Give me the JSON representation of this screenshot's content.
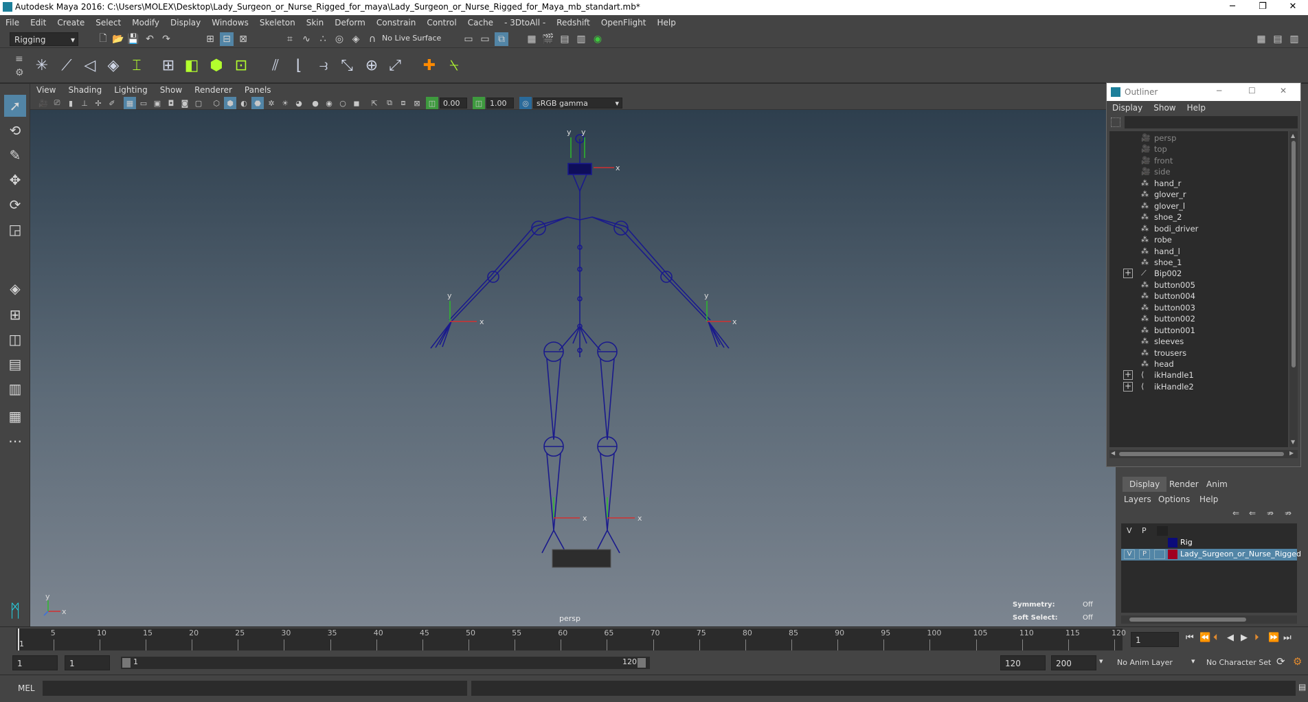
{
  "window": {
    "title": "Autodesk Maya 2016: C:\\Users\\MOLEX\\Desktop\\Lady_Surgeon_or_Nurse_Rigged_for_maya\\Lady_Surgeon_or_Nurse_Rigged_for_Maya_mb_standart.mb*"
  },
  "menubar": [
    "File",
    "Edit",
    "Create",
    "Select",
    "Modify",
    "Display",
    "Windows",
    "Skeleton",
    "Skin",
    "Deform",
    "Constrain",
    "Control",
    "Cache",
    "- 3DtoAll -",
    "Redshift",
    "OpenFlight",
    "Help"
  ],
  "status_line": {
    "mode": "Rigging",
    "live_surface": "No Live Surface"
  },
  "panel_menu": [
    "View",
    "Shading",
    "Lighting",
    "Show",
    "Renderer",
    "Panels"
  ],
  "panel_toolbar": {
    "exposure": "0.00",
    "gamma": "1.00",
    "color_space": "sRGB gamma"
  },
  "viewport": {
    "camera_name": "persp",
    "symmetry_label": "Symmetry:",
    "symmetry_value": "Off",
    "soft_select_label": "Soft Select:",
    "soft_select_value": "Off",
    "axis_x": "x",
    "axis_y": "y"
  },
  "outliner": {
    "title": "Outliner",
    "menu": [
      "Display",
      "Show",
      "Help"
    ],
    "items": [
      {
        "name": "persp",
        "kind": "camera",
        "expandable": false
      },
      {
        "name": "top",
        "kind": "camera",
        "expandable": false
      },
      {
        "name": "front",
        "kind": "camera",
        "expandable": false
      },
      {
        "name": "side",
        "kind": "camera",
        "expandable": false
      },
      {
        "name": "hand_r",
        "kind": "mesh",
        "expandable": false
      },
      {
        "name": "glover_r",
        "kind": "mesh",
        "expandable": false
      },
      {
        "name": "glover_l",
        "kind": "mesh",
        "expandable": false
      },
      {
        "name": "shoe_2",
        "kind": "mesh",
        "expandable": false
      },
      {
        "name": "bodi_driver",
        "kind": "mesh",
        "expandable": false
      },
      {
        "name": "robe",
        "kind": "mesh",
        "expandable": false
      },
      {
        "name": "hand_l",
        "kind": "mesh",
        "expandable": false
      },
      {
        "name": "shoe_1",
        "kind": "mesh",
        "expandable": false
      },
      {
        "name": "Bip002",
        "kind": "joint",
        "expandable": true
      },
      {
        "name": "button005",
        "kind": "mesh",
        "expandable": false
      },
      {
        "name": "button004",
        "kind": "mesh",
        "expandable": false
      },
      {
        "name": "button003",
        "kind": "mesh",
        "expandable": false
      },
      {
        "name": "button002",
        "kind": "mesh",
        "expandable": false
      },
      {
        "name": "button001",
        "kind": "mesh",
        "expandable": false
      },
      {
        "name": "sleeves",
        "kind": "mesh",
        "expandable": false
      },
      {
        "name": "trousers",
        "kind": "mesh",
        "expandable": false
      },
      {
        "name": "head",
        "kind": "mesh",
        "expandable": false
      },
      {
        "name": "ikHandle1",
        "kind": "ik",
        "expandable": true
      },
      {
        "name": "ikHandle2",
        "kind": "ik",
        "expandable": true
      }
    ]
  },
  "layer_editor": {
    "tabs": [
      "Display",
      "Render",
      "Anim"
    ],
    "active_tab": "Display",
    "submenu": [
      "Layers",
      "Options",
      "Help"
    ],
    "header_v": "V",
    "header_p": "P",
    "rows": [
      {
        "name": "Rig",
        "v": "",
        "p": "",
        "color": "#0b0b7a",
        "selected": false
      },
      {
        "name": "Lady_Surgeon_or_Nurse_Rigged",
        "v": "V",
        "p": "P",
        "color": "#a00020",
        "selected": true
      }
    ]
  },
  "timeline": {
    "ticks": [
      "5",
      "10",
      "15",
      "20",
      "25",
      "30",
      "35",
      "40",
      "45",
      "50",
      "55",
      "60",
      "65",
      "70",
      "75",
      "80",
      "85",
      "90",
      "95",
      "100",
      "105",
      "110",
      "115",
      "120"
    ],
    "start_label": "1",
    "current_frame": "1",
    "current_frame_start": "1"
  },
  "range": {
    "start": "1",
    "playback_start": "1",
    "range_start_label": "1",
    "range_end_label": "120",
    "playback_end": "120",
    "end": "200",
    "anim_layer": "No Anim Layer",
    "character_set": "No Character Set"
  },
  "command_line": {
    "language": "MEL"
  },
  "colors": {
    "accent": "#5285a6",
    "joint": "#1a1a8c",
    "axis_x": "#d23030",
    "axis_y": "#2dbb2d"
  }
}
